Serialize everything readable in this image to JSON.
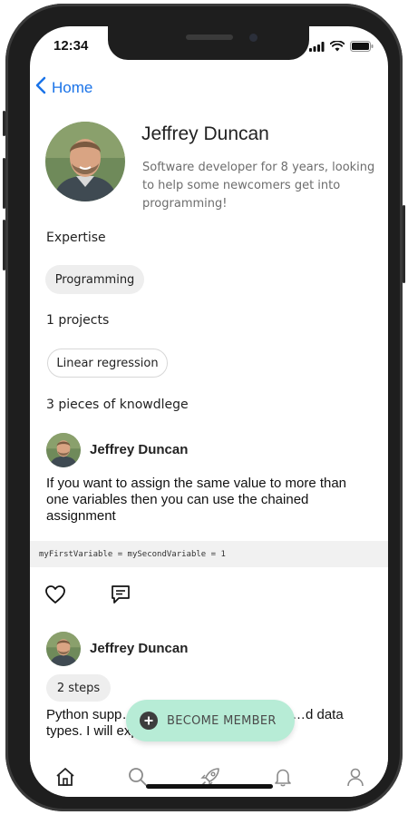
{
  "status_bar": {
    "time": "12:34"
  },
  "nav": {
    "back_label": "Home"
  },
  "profile": {
    "name": "Jeffrey Duncan",
    "bio": "Software developer for 8 years, looking to help some newcomers get into programming!"
  },
  "expertise": {
    "heading": "Expertise",
    "tags": [
      "Programming"
    ]
  },
  "projects": {
    "heading": "1 projects",
    "items": [
      "Linear regression"
    ]
  },
  "knowledge": {
    "heading": "3 pieces of knowdlege"
  },
  "posts": [
    {
      "author": "Jeffrey Duncan",
      "text": "If you want to assign the same value to more than one variables then you can use the chained assignment",
      "code": "myFirstVariable = mySecondVariable = 1"
    },
    {
      "author": "Jeffrey Duncan",
      "badge": "2 steps",
      "text": "Python supp…, lists, tuples and dictionar…d data types. I will explain them in detail."
    }
  ],
  "fab": {
    "label": "BECOME MEMBER"
  },
  "tabbar": {
    "icons": [
      "home-icon",
      "search-icon",
      "rocket-icon",
      "bell-icon",
      "user-icon"
    ]
  },
  "colors": {
    "accent": "#1a73e8",
    "fab_bg": "#b7ecd6",
    "chip_bg": "#eeeeee"
  }
}
